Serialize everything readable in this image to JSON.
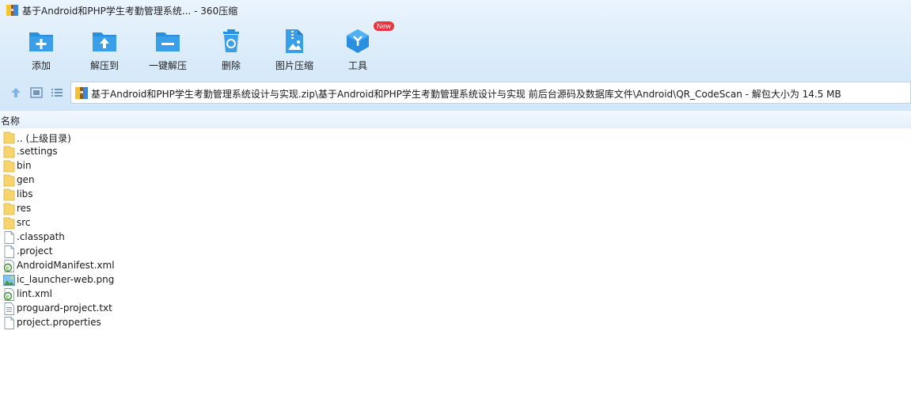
{
  "window": {
    "title": "基于Android和PHP学生考勤管理系统... - 360压缩"
  },
  "toolbar": {
    "tools": [
      {
        "label": "添加",
        "icon": "add-icon"
      },
      {
        "label": "解压到",
        "icon": "extract-to-icon"
      },
      {
        "label": "一键解压",
        "icon": "one-click-extract-icon"
      },
      {
        "label": "删除",
        "icon": "delete-icon"
      },
      {
        "label": "图片压缩",
        "icon": "image-compress-icon"
      },
      {
        "label": "工具",
        "icon": "tools-icon",
        "badge": "New"
      }
    ]
  },
  "nav": {
    "path": "基于Android和PHP学生考勤管理系统设计与实现.zip\\基于Android和PHP学生考勤管理系统设计与实现 前后台源码及数据库文件\\Android\\QR_CodeScan - 解包大小为 14.5 MB"
  },
  "list": {
    "column_name": "名称",
    "files": [
      {
        "name": ".. (上级目录)",
        "icon": "folder-icon"
      },
      {
        "name": ".settings",
        "icon": "folder-icon"
      },
      {
        "name": "bin",
        "icon": "folder-icon"
      },
      {
        "name": "gen",
        "icon": "folder-icon"
      },
      {
        "name": "libs",
        "icon": "folder-icon"
      },
      {
        "name": "res",
        "icon": "folder-icon"
      },
      {
        "name": "src",
        "icon": "folder-icon"
      },
      {
        "name": ".classpath",
        "icon": "file-icon"
      },
      {
        "name": ".project",
        "icon": "file-icon"
      },
      {
        "name": "AndroidManifest.xml",
        "icon": "xml-file-icon"
      },
      {
        "name": "ic_launcher-web.png",
        "icon": "image-file-icon"
      },
      {
        "name": "lint.xml",
        "icon": "xml-file-icon"
      },
      {
        "name": "proguard-project.txt",
        "icon": "text-file-icon"
      },
      {
        "name": "project.properties",
        "icon": "file-icon"
      }
    ]
  },
  "colors": {
    "accent": "#2a8fe0",
    "toolbar_bg": "#d9ebfa",
    "badge": "#e8343c",
    "folder": "#f7d56a"
  }
}
